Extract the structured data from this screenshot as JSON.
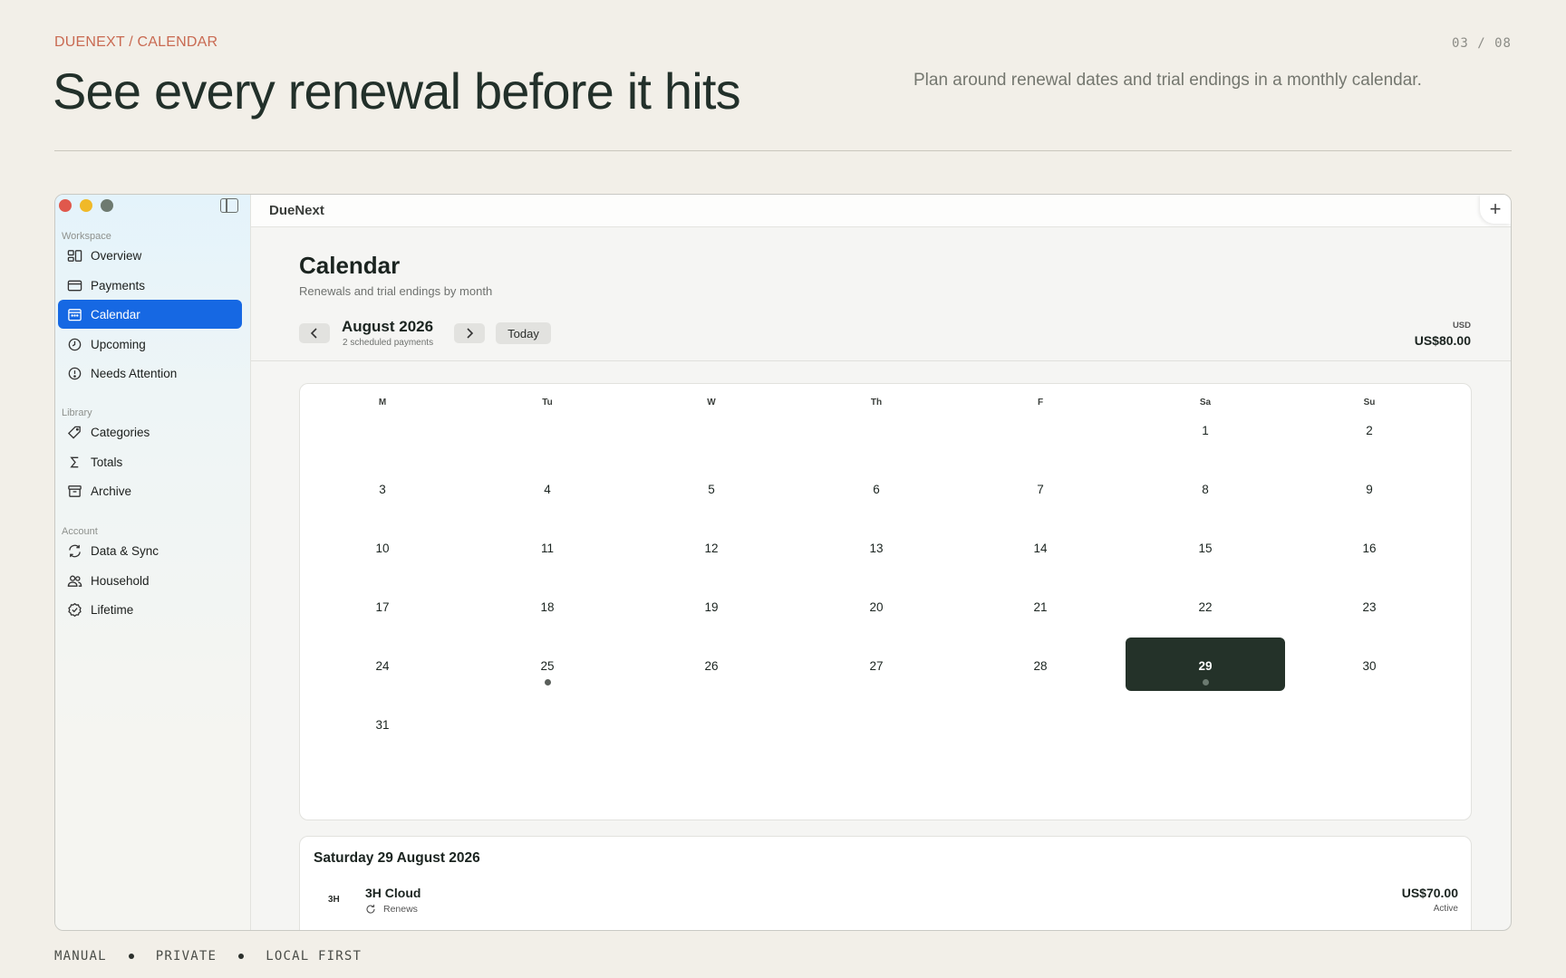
{
  "slide": {
    "breadcrumb": "DUENEXT / CALENDAR",
    "page_number": "03 / 08",
    "headline": "See every renewal before it hits",
    "subline": "Plan around renewal dates and trial endings in a monthly calendar.",
    "footer": [
      "MANUAL",
      "PRIVATE",
      "LOCAL FIRST"
    ]
  },
  "app": {
    "title": "DueNext",
    "add_label": "+"
  },
  "sidebar": {
    "sections": [
      {
        "label": "Workspace",
        "items": [
          {
            "label": "Overview",
            "icon": "overview-icon",
            "active": false
          },
          {
            "label": "Payments",
            "icon": "card-icon",
            "active": false
          },
          {
            "label": "Calendar",
            "icon": "calendar-icon",
            "active": true
          },
          {
            "label": "Upcoming",
            "icon": "clock-icon",
            "active": false
          },
          {
            "label": "Needs Attention",
            "icon": "alert-icon",
            "active": false
          }
        ]
      },
      {
        "label": "Library",
        "items": [
          {
            "label": "Categories",
            "icon": "tag-icon",
            "active": false
          },
          {
            "label": "Totals",
            "icon": "sigma-icon",
            "active": false
          },
          {
            "label": "Archive",
            "icon": "archive-icon",
            "active": false
          }
        ]
      },
      {
        "label": "Account",
        "items": [
          {
            "label": "Data & Sync",
            "icon": "sync-icon",
            "active": false
          },
          {
            "label": "Household",
            "icon": "people-icon",
            "active": false
          },
          {
            "label": "Lifetime",
            "icon": "badge-check-icon",
            "active": false
          }
        ]
      }
    ]
  },
  "calendar": {
    "title": "Calendar",
    "subtitle": "Renewals and trial endings by month",
    "month_label": "August 2026",
    "month_summary": "2 scheduled payments",
    "today_label": "Today",
    "currency_label": "USD",
    "currency_total": "US$80.00",
    "weekdays": [
      "M",
      "Tu",
      "W",
      "Th",
      "F",
      "Sa",
      "Su"
    ],
    "first_weekday_index": 5,
    "days_in_month": 31,
    "selected_day": 29,
    "marked_days": [
      25,
      29
    ]
  },
  "detail": {
    "title": "Saturday 29 August 2026",
    "items": [
      {
        "badge": "3H",
        "name": "3H Cloud",
        "kind": "Renews",
        "amount": "US$70.00",
        "status": "Active"
      }
    ]
  },
  "colors": {
    "accent": "#1668e3",
    "selected_day_bg": "#243229",
    "breadcrumb": "#c96a52",
    "background": "#f2efe8"
  }
}
